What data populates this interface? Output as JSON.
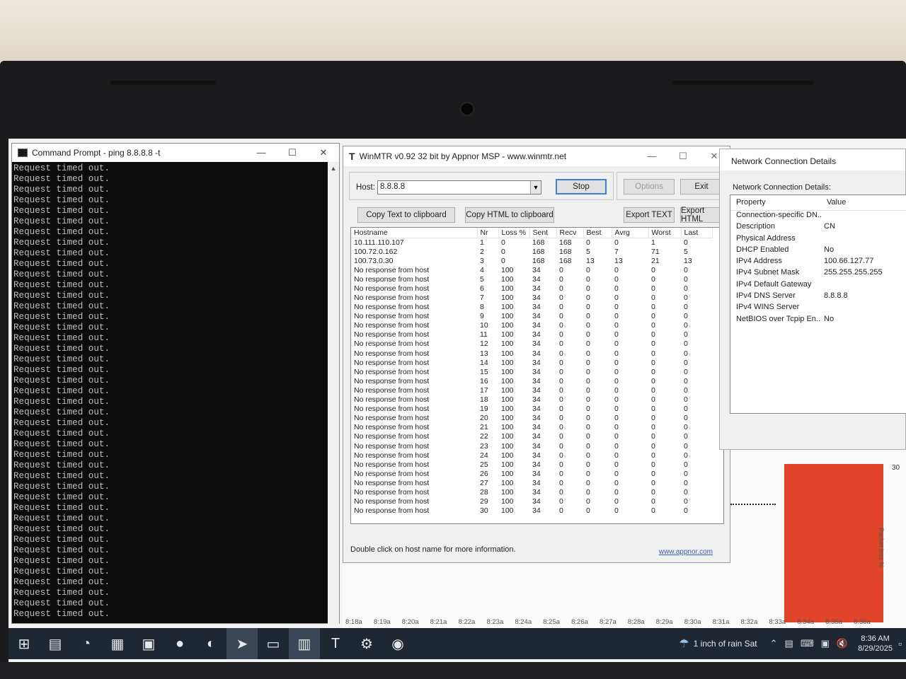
{
  "cmd": {
    "title": "Command Prompt - ping  8.8.8.8 -t",
    "lines": [
      "Request timed out.",
      "Request timed out.",
      "Request timed out.",
      "Request timed out.",
      "Request timed out.",
      "Request timed out.",
      "Request timed out.",
      "Request timed out.",
      "Request timed out.",
      "Request timed out.",
      "Request timed out.",
      "Request timed out.",
      "Request timed out.",
      "Request timed out.",
      "Request timed out.",
      "Request timed out.",
      "Request timed out.",
      "Request timed out.",
      "Request timed out.",
      "Request timed out.",
      "Request timed out.",
      "Request timed out.",
      "Request timed out.",
      "Request timed out.",
      "Request timed out.",
      "Request timed out.",
      "Request timed out.",
      "Request timed out.",
      "Request timed out.",
      "Request timed out.",
      "Request timed out.",
      "Request timed out.",
      "Request timed out.",
      "Request timed out.",
      "Request timed out.",
      "Request timed out.",
      "Request timed out.",
      "Request timed out.",
      "Request timed out.",
      "Request timed out.",
      "Request timed out.",
      "Request timed out.",
      "Request timed out."
    ]
  },
  "mtr": {
    "title": "WinMTR v0.92 32 bit by Appnor MSP - www.winmtr.net",
    "host_label": "Host:",
    "host_value": "8.8.8.8",
    "stop_label": "Stop",
    "options_label": "Options",
    "exit_label": "Exit",
    "copy_text_label": "Copy Text to clipboard",
    "copy_html_label": "Copy HTML to clipboard",
    "export_text_label": "Export TEXT",
    "export_html_label": "Export HTML",
    "columns": [
      "Hostname",
      "Nr",
      "Loss %",
      "Sent",
      "Recv",
      "Best",
      "Avrg",
      "Worst",
      "Last"
    ],
    "rows": [
      [
        "10.111.110.107",
        "1",
        "0",
        "168",
        "168",
        "0",
        "0",
        "1",
        "0"
      ],
      [
        "100.72.0.162",
        "2",
        "0",
        "168",
        "168",
        "5",
        "7",
        "71",
        "5"
      ],
      [
        "100.73.0.30",
        "3",
        "0",
        "168",
        "168",
        "13",
        "13",
        "21",
        "13"
      ],
      [
        "No response from host",
        "4",
        "100",
        "34",
        "0",
        "0",
        "0",
        "0",
        "0"
      ],
      [
        "No response from host",
        "5",
        "100",
        "34",
        "0",
        "0",
        "0",
        "0",
        "0"
      ],
      [
        "No response from host",
        "6",
        "100",
        "34",
        "0",
        "0",
        "0",
        "0",
        "0"
      ],
      [
        "No response from host",
        "7",
        "100",
        "34",
        "0",
        "0",
        "0",
        "0",
        "0"
      ],
      [
        "No response from host",
        "8",
        "100",
        "34",
        "0",
        "0",
        "0",
        "0",
        "0"
      ],
      [
        "No response from host",
        "9",
        "100",
        "34",
        "0",
        "0",
        "0",
        "0",
        "0"
      ],
      [
        "No response from host",
        "10",
        "100",
        "34",
        "0",
        "0",
        "0",
        "0",
        "0"
      ],
      [
        "No response from host",
        "11",
        "100",
        "34",
        "0",
        "0",
        "0",
        "0",
        "0"
      ],
      [
        "No response from host",
        "12",
        "100",
        "34",
        "0",
        "0",
        "0",
        "0",
        "0"
      ],
      [
        "No response from host",
        "13",
        "100",
        "34",
        "0",
        "0",
        "0",
        "0",
        "0"
      ],
      [
        "No response from host",
        "14",
        "100",
        "34",
        "0",
        "0",
        "0",
        "0",
        "0"
      ],
      [
        "No response from host",
        "15",
        "100",
        "34",
        "0",
        "0",
        "0",
        "0",
        "0"
      ],
      [
        "No response from host",
        "16",
        "100",
        "34",
        "0",
        "0",
        "0",
        "0",
        "0"
      ],
      [
        "No response from host",
        "17",
        "100",
        "34",
        "0",
        "0",
        "0",
        "0",
        "0"
      ],
      [
        "No response from host",
        "18",
        "100",
        "34",
        "0",
        "0",
        "0",
        "0",
        "0"
      ],
      [
        "No response from host",
        "19",
        "100",
        "34",
        "0",
        "0",
        "0",
        "0",
        "0"
      ],
      [
        "No response from host",
        "20",
        "100",
        "34",
        "0",
        "0",
        "0",
        "0",
        "0"
      ],
      [
        "No response from host",
        "21",
        "100",
        "34",
        "0",
        "0",
        "0",
        "0",
        "0"
      ],
      [
        "No response from host",
        "22",
        "100",
        "34",
        "0",
        "0",
        "0",
        "0",
        "0"
      ],
      [
        "No response from host",
        "23",
        "100",
        "34",
        "0",
        "0",
        "0",
        "0",
        "0"
      ],
      [
        "No response from host",
        "24",
        "100",
        "34",
        "0",
        "0",
        "0",
        "0",
        "0"
      ],
      [
        "No response from host",
        "25",
        "100",
        "34",
        "0",
        "0",
        "0",
        "0",
        "0"
      ],
      [
        "No response from host",
        "26",
        "100",
        "34",
        "0",
        "0",
        "0",
        "0",
        "0"
      ],
      [
        "No response from host",
        "27",
        "100",
        "34",
        "0",
        "0",
        "0",
        "0",
        "0"
      ],
      [
        "No response from host",
        "28",
        "100",
        "34",
        "0",
        "0",
        "0",
        "0",
        "0"
      ],
      [
        "No response from host",
        "29",
        "100",
        "34",
        "0",
        "0",
        "0",
        "0",
        "0"
      ],
      [
        "No response from host",
        "30",
        "100",
        "34",
        "0",
        "0",
        "0",
        "0",
        "0"
      ]
    ],
    "hint": "Double click on host name for more information.",
    "site": "www.appnor.com"
  },
  "ncd": {
    "title": "Network Connection Details",
    "subtitle": "Network Connection Details:",
    "col_property": "Property",
    "col_value": "Value",
    "rows": [
      [
        "Connection-specific DN...",
        ""
      ],
      [
        "Description",
        "CN"
      ],
      [
        "Physical Address",
        ""
      ],
      [
        "DHCP Enabled",
        "No"
      ],
      [
        "IPv4 Address",
        "100.66.127.77"
      ],
      [
        "IPv4 Subnet Mask",
        "255.255.255.255"
      ],
      [
        "IPv4 Default Gateway",
        ""
      ],
      [
        "IPv4 DNS Server",
        "8.8.8.8"
      ],
      [
        "IPv4 WINS Server",
        ""
      ],
      [
        "NetBIOS over Tcpip En...",
        "No"
      ]
    ]
  },
  "graph": {
    "value_label": "30",
    "y_label": "Packet loss %",
    "bar_color": "#e0452a",
    "ticks": [
      "8:18a",
      "8:19a",
      "8:20a",
      "8:21a",
      "8:22a",
      "8:23a",
      "8:24a",
      "8:25a",
      "8:26a",
      "8:27a",
      "8:28a",
      "8:29a",
      "8:30a",
      "8:31a",
      "8:32a",
      "8:33a",
      "8:34a",
      "8:35a",
      "8:36a"
    ]
  },
  "taskbar": {
    "icons": [
      "windows-start-icon",
      "file-explorer-icon",
      "edge-icon",
      "calculator-icon",
      "photos-icon",
      "app-icon",
      "app2-icon",
      "telegram-icon",
      "terminal-icon",
      "network-monitor-icon",
      "winmtr-icon",
      "settings-icon",
      "app3-icon"
    ],
    "weather": "1 inch of rain Sat",
    "time": "8:36 AM",
    "date": "8/29/2025"
  }
}
